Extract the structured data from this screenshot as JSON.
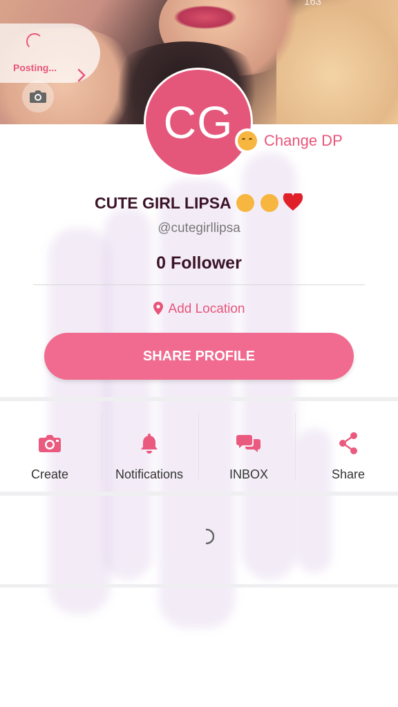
{
  "cover": {
    "top_number": "163"
  },
  "posting": {
    "label": "Posting..."
  },
  "profile": {
    "avatar_initials": "CG",
    "change_dp_label": "Change DP",
    "name": "CUTE GIRL LIPSA",
    "name_emojis": [
      "smiling-face-with-hearts",
      "face-blowing-kiss",
      "red-heart"
    ],
    "handle": "@cutegirllipsa",
    "followers": "0 Follower",
    "location_label": "Add Location",
    "share_button": "SHARE PROFILE"
  },
  "actions": [
    {
      "label": "Create",
      "icon": "camera-icon"
    },
    {
      "label": "Notifications",
      "icon": "bell-icon"
    },
    {
      "label": "INBOX",
      "icon": "chat-icon"
    },
    {
      "label": "Share",
      "icon": "share-icon"
    }
  ],
  "colors": {
    "accent": "#e8557a",
    "button": "#f06b8f",
    "name": "#3a1426"
  }
}
